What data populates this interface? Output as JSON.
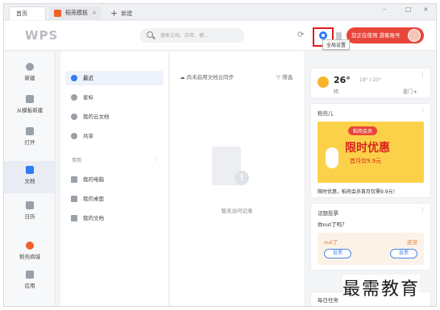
{
  "tabs": {
    "home": "首页",
    "doc": "稻壳模板",
    "doc_close": "×",
    "new_tab": "新建"
  },
  "window": {
    "minimize": "–",
    "maximize": "□",
    "close": "×"
  },
  "header": {
    "brand": "WPS",
    "search_placeholder": "搜索文档、应用、模...",
    "settings_tooltip": "全局设置",
    "login_label": "您正在使用 游客账号"
  },
  "sidebar": {
    "items": [
      {
        "label": "新建",
        "icon": "plus-icon",
        "color": "#9aa0a8"
      },
      {
        "label": "从模板新建",
        "icon": "template-icon",
        "color": "#9aa0a8"
      },
      {
        "label": "打开",
        "icon": "folder-icon",
        "color": "#9aa0a8"
      },
      {
        "label": "文档",
        "icon": "document-icon",
        "color": "#2f7cf6"
      },
      {
        "label": "日历",
        "icon": "calendar-icon",
        "color": "#9aa0a8"
      },
      {
        "label": "稻壳商城",
        "icon": "store-icon",
        "color": "#f0602b"
      },
      {
        "label": "应用",
        "icon": "apps-icon",
        "color": "#9aa0a8"
      }
    ]
  },
  "nav": {
    "items": [
      {
        "label": "最近",
        "icon": "clock-icon",
        "color": "#2f7cf6"
      },
      {
        "label": "星标",
        "icon": "star-icon",
        "color": "#9aa0a8"
      },
      {
        "label": "我的云文档",
        "icon": "cloud-icon",
        "color": "#9aa0a8"
      },
      {
        "label": "共享",
        "icon": "share-icon",
        "color": "#9aa0a8"
      }
    ],
    "group_label": "常用",
    "group_more": "⋮",
    "common": [
      {
        "label": "我的电脑",
        "icon": "computer-icon"
      },
      {
        "label": "我的桌面",
        "icon": "desktop-icon"
      },
      {
        "label": "我的文档",
        "icon": "folder-icon"
      }
    ]
  },
  "main": {
    "sync_label": "尚未启用文档云同步",
    "filter_label": "筛选",
    "empty_text": "暂无访问记录"
  },
  "weather": {
    "temp": "26°",
    "range": "19° / 23°",
    "condition": "晴",
    "city": "厦门 ▾"
  },
  "promo": {
    "title": "稻壳儿",
    "tag": "稻壳会员",
    "headline": "限时优惠",
    "subline": "首月仅9.9元",
    "note": "限时优惠，稻壳会员首月仅需9.9元！"
  },
  "vote": {
    "title": "话题投票",
    "question": "你out了吗？",
    "left": "out了",
    "right": "还没",
    "left_btn": "投票",
    "right_btn": "投票"
  },
  "task": {
    "title": "每日任务"
  },
  "watermark": "最需教育"
}
